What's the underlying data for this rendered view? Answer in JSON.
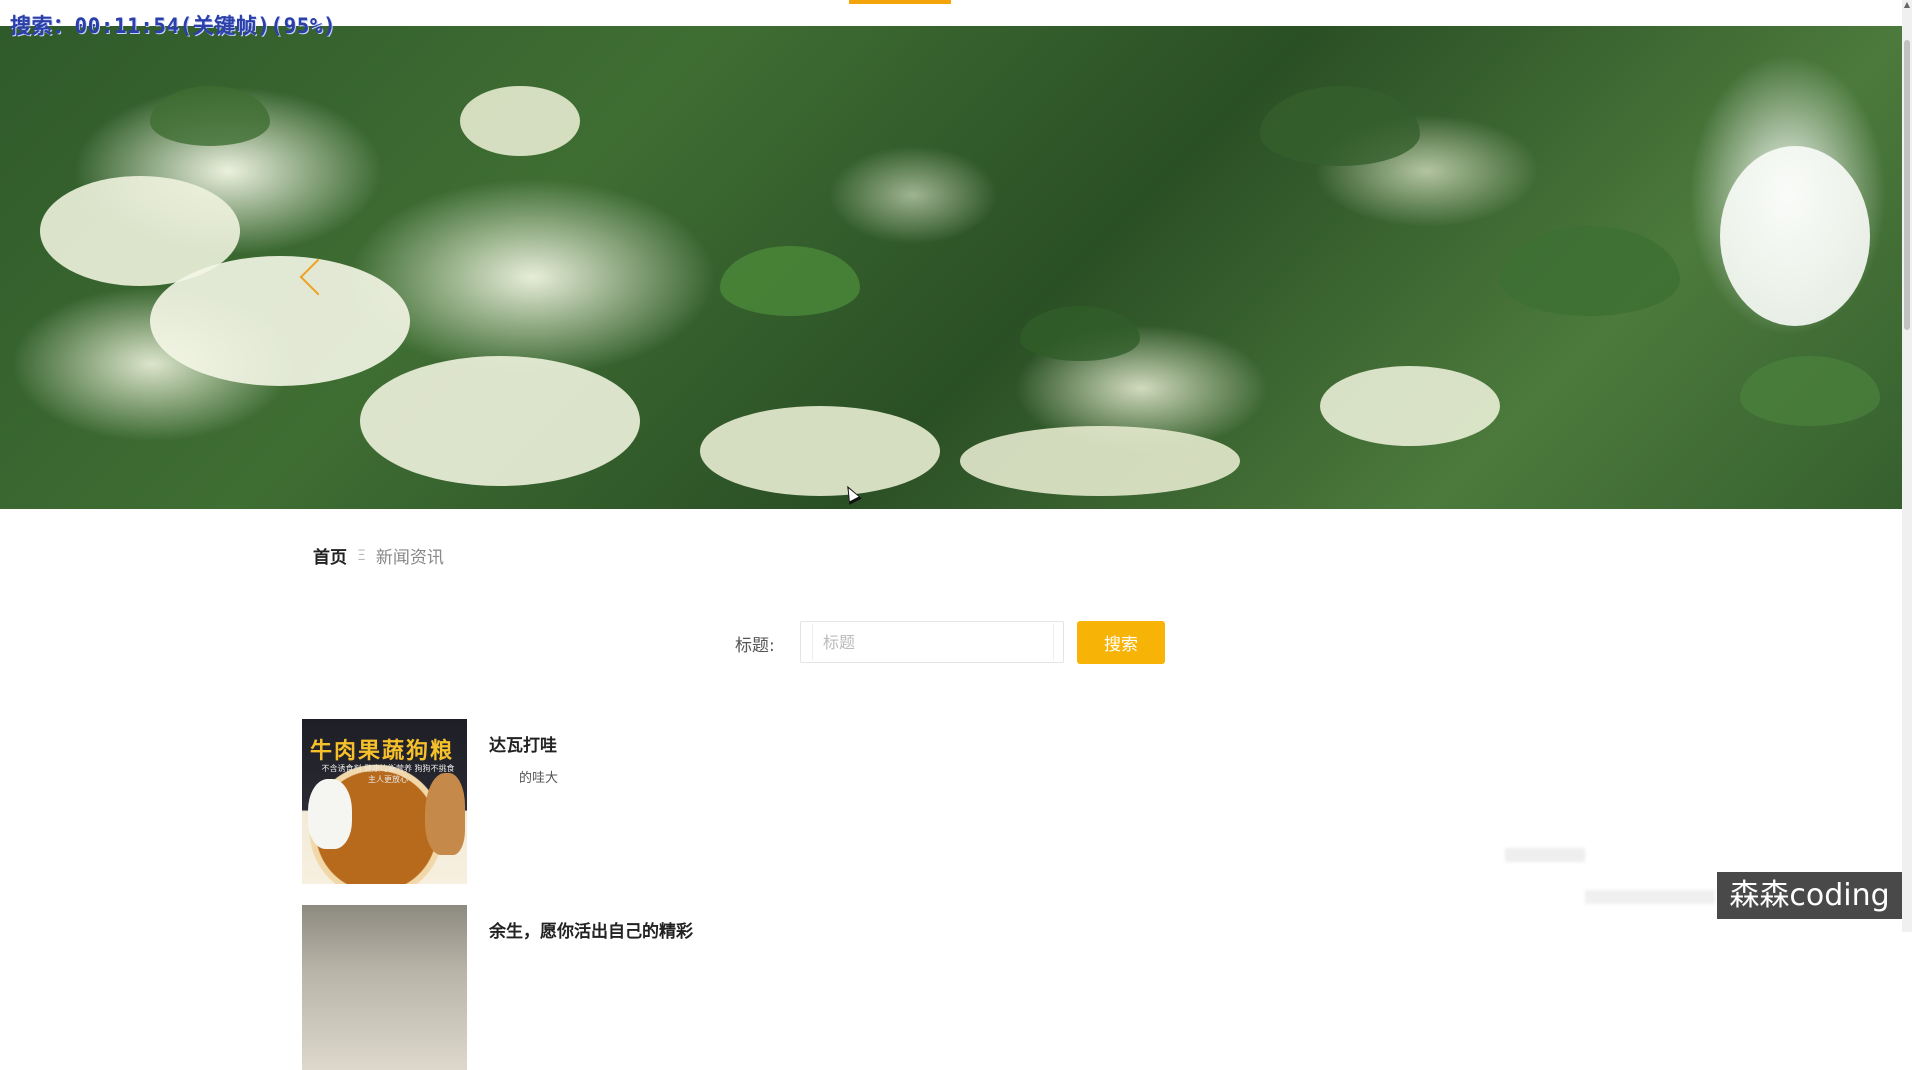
{
  "overlay": {
    "search_status": "搜索：00:11:54(关键帧)(95%)",
    "brand_watermark": "森森coding"
  },
  "breadcrumb": {
    "home": "首页",
    "separator": "Ξ",
    "current": "新闻资讯"
  },
  "search": {
    "label": "标题:",
    "placeholder": "标题",
    "value": "",
    "button_label": "搜索"
  },
  "news": [
    {
      "title": "达瓦打哇",
      "description": "的哇大",
      "thumbnail_text": "牛肉果蔬狗粮",
      "thumbnail_subtext": "不含诱食剂 健康均衡营养 狗狗不挑食 主人更放心"
    },
    {
      "title": "余生，愿你活出自己的精彩",
      "description": ""
    }
  ],
  "colors": {
    "accent": "#f7b406",
    "top_accent": "#f5a30a",
    "title_text": "#222222",
    "muted_text": "#888888"
  },
  "icons": {
    "banner_prev": "chevron-left-icon",
    "cursor": "mouse-pointer-icon"
  }
}
